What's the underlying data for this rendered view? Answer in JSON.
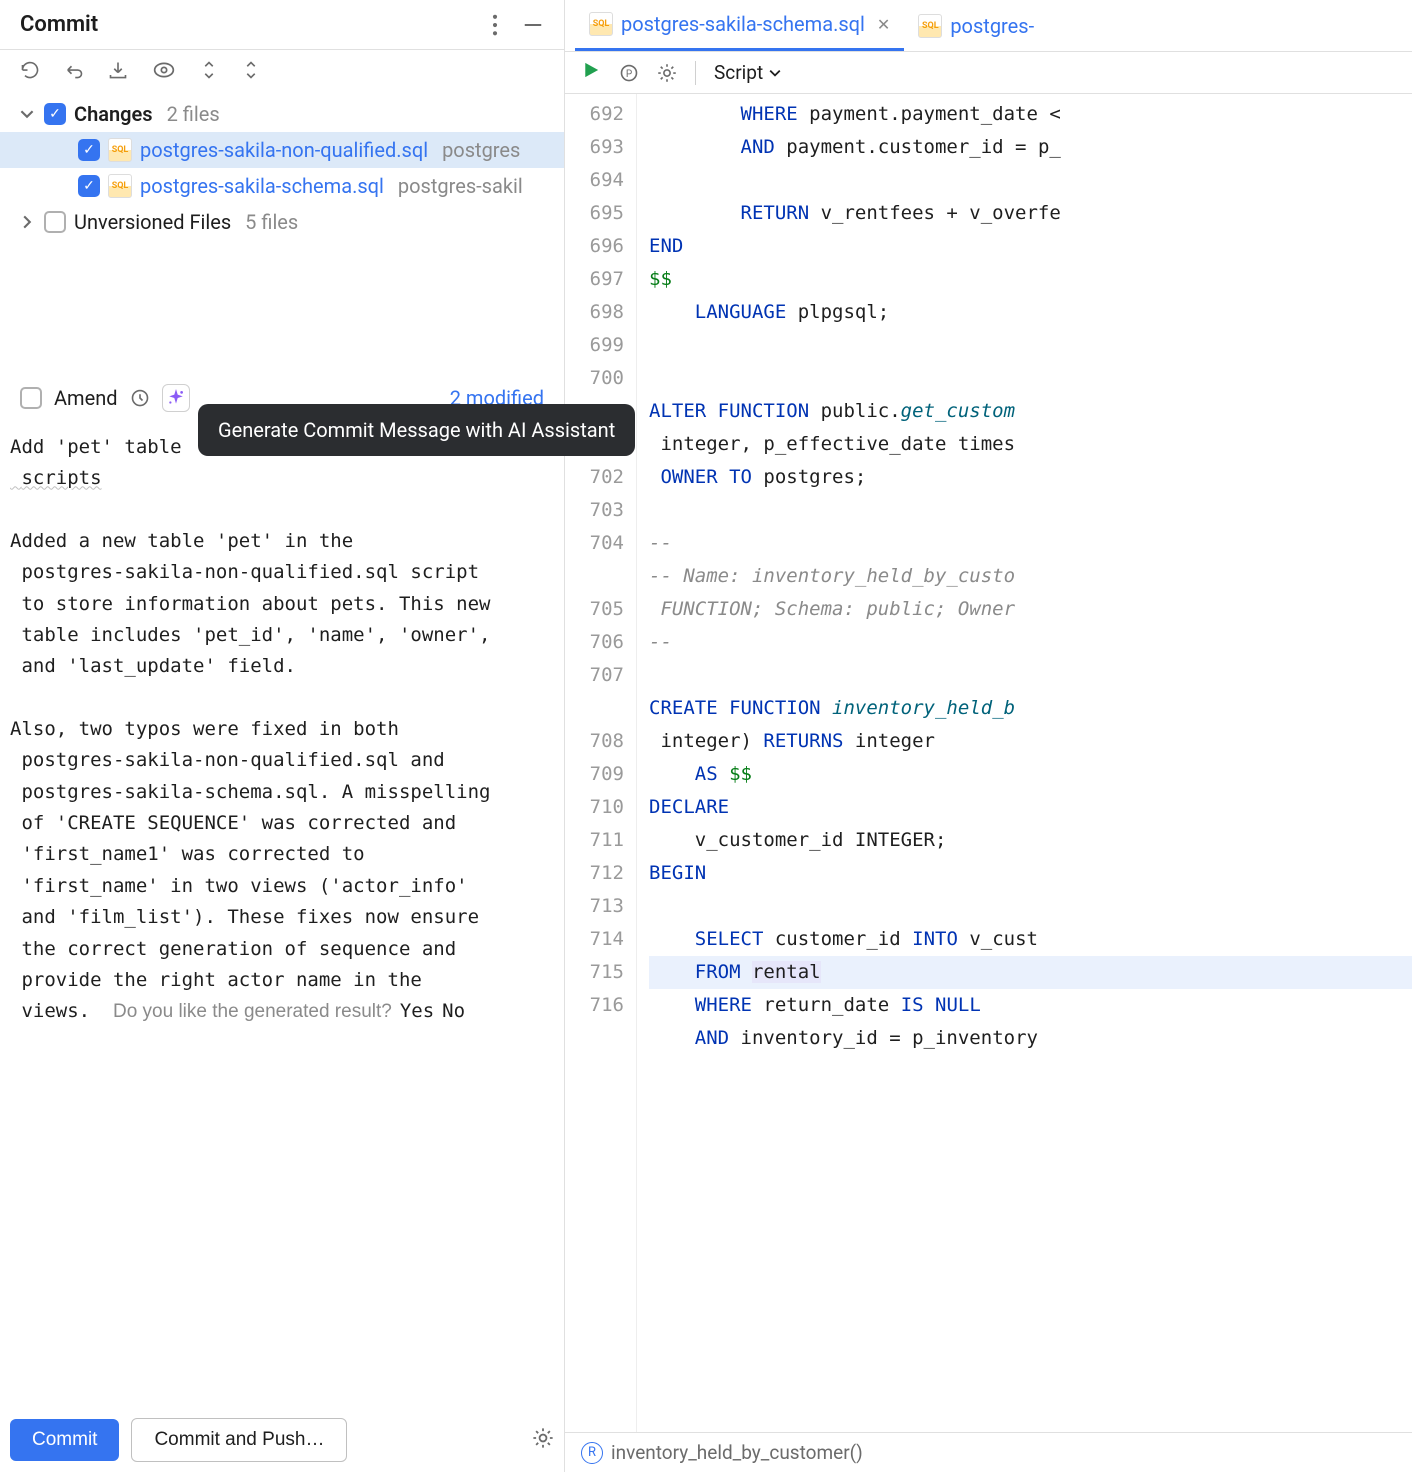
{
  "panel": {
    "title": "Commit",
    "changes_label": "Changes",
    "changes_count": "2 files",
    "unversioned_label": "Unversioned Files",
    "unversioned_count": "5 files",
    "files": [
      {
        "name": "postgres-sakila-non-qualified.sql",
        "path": "postgres"
      },
      {
        "name": "postgres-sakila-schema.sql",
        "path": "postgres-sakil"
      }
    ],
    "amend_label": "Amend",
    "modified_label": "2 modified",
    "tooltip": "Generate Commit Message with AI Assistant",
    "commit_message": "Add 'pet' table",
    "commit_body_l1": " scripts",
    "commit_body": "Added a new table 'pet' in the\n postgres-sakila-non-qualified.sql script\n to store information about pets. This new\n table includes 'pet_id', 'name', 'owner',\n and 'last_update' field.\n\nAlso, two typos were fixed in both\n postgres-sakila-non-qualified.sql and\n postgres-sakila-schema.sql. A misspelling\n of 'CREATE SEQUENCE' was corrected and\n 'first_name1' was corrected to\n 'first_name' in two views ('actor_info'\n and 'film_list'). These fixes now ensure\n the correct generation of sequence and\n provide the right actor name in the\n views.",
    "gen_prompt": "Do you like the generated result?",
    "gen_yes": "Yes",
    "gen_no": "No",
    "commit_btn": "Commit",
    "commit_push_btn": "Commit and Push…"
  },
  "editor": {
    "tabs": [
      {
        "label": "postgres-sakila-schema.sql",
        "active": true,
        "close": true
      },
      {
        "label": "postgres-",
        "active": false,
        "close": false
      }
    ],
    "script_label": "Script",
    "status_fn": "inventory_held_by_customer()",
    "gutter": [
      "692",
      "693",
      "694",
      "695",
      "696",
      "697",
      "698",
      "699",
      "700",
      "",
      "",
      "702",
      "703",
      "704",
      "",
      "705",
      "706",
      "707",
      "",
      "708",
      "709",
      "710",
      "711",
      "712",
      "713",
      "714",
      "715",
      "716"
    ],
    "code_lines": [
      {
        "t": "        WHERE payment.payment_date <",
        "kw": [
          "WHERE"
        ]
      },
      {
        "t": "        AND payment.customer_id = p_",
        "kw": [
          "AND"
        ]
      },
      {
        "t": ""
      },
      {
        "t": "        RETURN v_rentfees + v_overfe",
        "kw": [
          "RETURN"
        ]
      },
      {
        "t": "END",
        "kw": [
          "END"
        ]
      },
      {
        "t": "$$",
        "gr": true
      },
      {
        "t": "    LANGUAGE plpgsql;",
        "kw": [
          "LANGUAGE"
        ]
      },
      {
        "t": ""
      },
      {
        "t": ""
      },
      {
        "raw": "<span class=\"kw\">ALTER FUNCTION</span> public.<span class=\"fn\">get_custom</span>"
      },
      {
        "raw": " integer, p_effective_date times"
      },
      {
        "raw": " <span class=\"kw\">OWNER TO</span> postgres;"
      },
      {
        "t": ""
      },
      {
        "t": "--",
        "cm": true
      },
      {
        "t": "-- Name: inventory_held_by_custo",
        "cm": true
      },
      {
        "t": " FUNCTION; Schema: public; Owner",
        "cm": true
      },
      {
        "t": "--",
        "cm": true
      },
      {
        "t": ""
      },
      {
        "raw": "<span class=\"kw\">CREATE FUNCTION</span> <span class=\"fn\">inventory_held_b</span>"
      },
      {
        "raw": " integer) <span class=\"kw\">RETURNS</span> integer"
      },
      {
        "raw": "    <span class=\"kw\">AS</span> <span class=\"gr\">$$</span>"
      },
      {
        "t": "DECLARE",
        "kw": [
          "DECLARE"
        ]
      },
      {
        "t": "    v_customer_id INTEGER;"
      },
      {
        "t": "BEGIN",
        "kw": [
          "BEGIN"
        ]
      },
      {
        "t": ""
      },
      {
        "raw": "    <span class=\"kw\">SELECT</span> customer_id <span class=\"kw\">INTO</span> v_cust"
      },
      {
        "raw": "    <span class=\"kw\">FROM</span> <span class=\"id-hl\">rental</span>",
        "hl": true
      },
      {
        "raw": "    <span class=\"kw\">WHERE</span> return_date <span class=\"kw\">IS NULL</span>"
      },
      {
        "raw": "    <span class=\"kw\">AND</span> inventory_id = p_inventory"
      }
    ]
  }
}
